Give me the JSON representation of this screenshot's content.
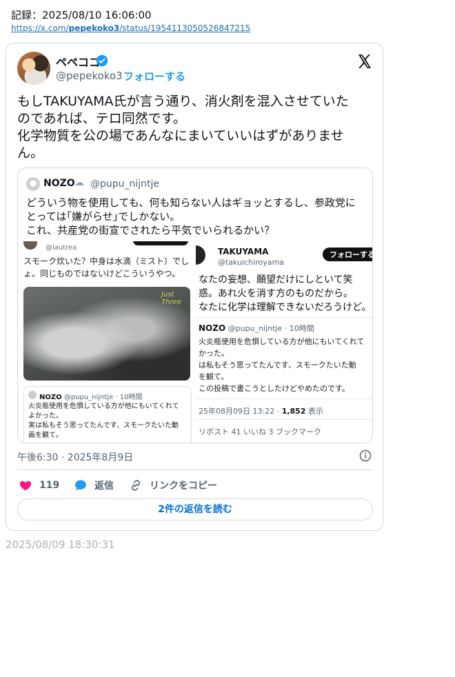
{
  "record": {
    "label": "記録：2025/08/10 16:06:00",
    "url_prefix": "https://x.com/",
    "url_user": "pepekoko3",
    "url_suffix": "/status/1954113050526847215"
  },
  "tweet": {
    "display_name": "ペペココ",
    "handle": "@pepekoko3",
    "separator": "·",
    "follow_label": "フォローする",
    "text_lines": [
      "もしTAKUYAMA氏が言う通り、消火剤を混入させていた",
      "のであれば、テロ同然です。",
      "化学物質を公の場であんなにまいていいはずがありませ",
      "ん。"
    ],
    "timestamp": "午後6:30 · 2025年8月9日",
    "like_count": "119",
    "reply_label": "返信",
    "copy_link_label": "リンクをコピー",
    "read_replies_label": "2件の返信を読む"
  },
  "quote": {
    "name": "NOZO",
    "cloud": "☁",
    "handle": "@pupu_nijntje",
    "text_lines": [
      "どういう物を使用しても、何も知らない人はギョッとするし、参政党に",
      "とっては｢嫌がらせ｣でしかない。",
      "これ、共産党の街宣でされたら平気でいられるかい？"
    ]
  },
  "shot_left": {
    "handle": "@lautrea",
    "text_lines": [
      "スモーク炊いた？中身は水滴（ミスト）でし",
      "ょ。同じものではないけどこういうやつ。"
    ],
    "image_tag": "Just Three",
    "card_name": "NOZO",
    "card_meta": "@pupu_nijntje · 10時間",
    "card_lines": [
      "火炎瓶使用を危惧している方が他にもいてくれて",
      "よかった。",
      "実は私もそう思ってたんです、スモークたいた動",
      "画を観て。"
    ]
  },
  "shot_right": {
    "name": "TAKUYAMA",
    "handle": "@takuichiroyama",
    "follow_label": "フォローする",
    "text_lines": [
      "なたの妄想、願望だけにしといて笑",
      "惑。あれ火を消す方のものだから。",
      "なたに化学は理解できないだろうけど。"
    ],
    "q_name": "NOZO",
    "q_meta": "@pupu_nijntje · 10時間",
    "q_lines": [
      "火炎瓶使用を危惧している方が他にもいてくれて",
      "かった。",
      "は私もそう思ってたんです、スモークたいた動",
      "を観て。",
      "この投稿で書こうとしたけどやめたのです。"
    ],
    "time": "25年08月09日 13:22 ·",
    "views": "1,852",
    "views_label": "表示",
    "stats": "リポスト  41 いいね  3 ブックマーク"
  },
  "capture_time": "2025/08/09 18:30:31",
  "colors": {
    "accent": "#1d9bf0",
    "like": "#f91880",
    "link": "#006fd6"
  }
}
